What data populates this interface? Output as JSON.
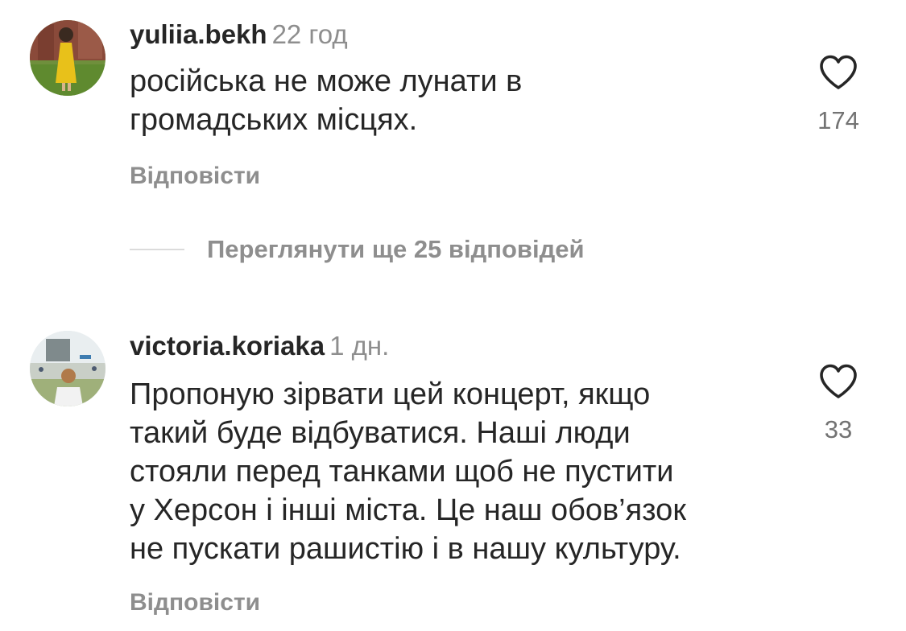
{
  "comments": [
    {
      "username": "yuliia.bekh",
      "time": "22 год",
      "lines": [
        "російська не може лунати в",
        "громадських місцях."
      ],
      "likes": "174",
      "reply_label": "Відповісти",
      "avatar": "avatar-photo"
    },
    {
      "username": "victoria.koriaka",
      "time": "1 дн.",
      "lines": [
        "Пропоную зірвати цей концерт, якщо",
        "такий буде відбуватися. Наші люди",
        "стояли перед танками щоб не пустити",
        "у Херсон і інші міста. Це наш обов’язок",
        "не пускати рашистію і в нашу культуру."
      ],
      "likes": "33",
      "reply_label": "Відповісти",
      "avatar": "avatar-photo"
    }
  ],
  "view_replies": {
    "label": "Переглянути ще 25 відповідей"
  },
  "icons": {
    "like": "heart-outline-icon"
  },
  "colors": {
    "text": "#262626",
    "muted": "#8e8e8e",
    "divider": "#dbdbdb"
  }
}
